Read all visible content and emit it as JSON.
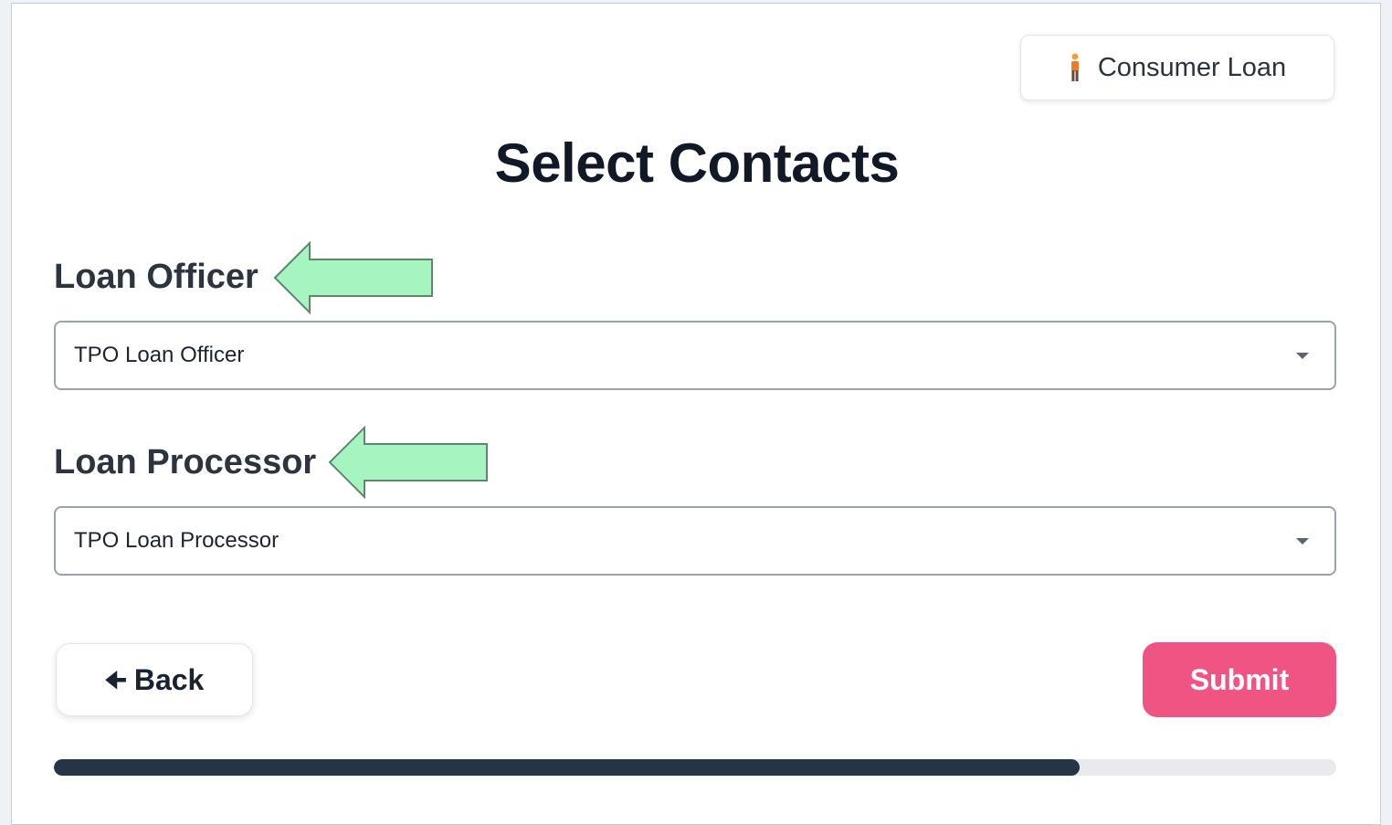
{
  "loan_type": {
    "label": "Consumer Loan",
    "icon": "person-icon"
  },
  "page": {
    "title": "Select Contacts"
  },
  "fields": {
    "loan_officer": {
      "label": "Loan Officer",
      "selected": "TPO Loan Officer"
    },
    "loan_processor": {
      "label": "Loan Processor",
      "selected": "TPO Loan Processor"
    }
  },
  "actions": {
    "back_label": "Back",
    "back_icon": "arrow-left-icon",
    "submit_label": "Submit"
  },
  "progress": {
    "percent": 80
  },
  "colors": {
    "submit": "#ef5482",
    "progress_fill": "#253446",
    "callout_arrow": "#a6f5c0"
  }
}
